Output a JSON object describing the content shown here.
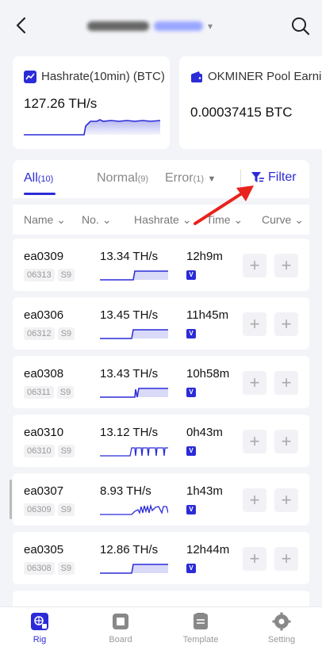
{
  "header": {
    "title_suffix": "▾"
  },
  "summary": {
    "hashrate": {
      "label": "Hashrate(10min) (BTC)",
      "value": "127.26 TH/s"
    },
    "earnings": {
      "label": "OKMINER Pool Earning",
      "value": "0.00037415 BTC"
    }
  },
  "tabs": {
    "all": {
      "label": "All",
      "count": "(10)"
    },
    "normal": {
      "label": "Normal",
      "count": "(9)"
    },
    "error": {
      "label": "Error",
      "count": "(1)"
    },
    "filter_label": "Filter"
  },
  "columns": [
    "Name",
    "No.",
    "Hashrate",
    "Time",
    "Curve"
  ],
  "rigs": [
    {
      "name": "ea0309",
      "no": "06313",
      "model": "S9",
      "hashrate": "13.34 TH/s",
      "time": "12h9m",
      "badge": "V"
    },
    {
      "name": "ea0306",
      "no": "06312",
      "model": "S9",
      "hashrate": "13.45 TH/s",
      "time": "11h45m",
      "badge": "V"
    },
    {
      "name": "ea0308",
      "no": "06311",
      "model": "S9",
      "hashrate": "13.43 TH/s",
      "time": "10h58m",
      "badge": "V"
    },
    {
      "name": "ea0310",
      "no": "06310",
      "model": "S9",
      "hashrate": "13.12 TH/s",
      "time": "0h43m",
      "badge": "V"
    },
    {
      "name": "ea0307",
      "no": "06309",
      "model": "S9",
      "hashrate": "8.93 TH/s",
      "time": "1h43m",
      "badge": "V"
    },
    {
      "name": "ea0305",
      "no": "06308",
      "model": "S9",
      "hashrate": "12.86 TH/s",
      "time": "12h44m",
      "badge": "V"
    }
  ],
  "tabbar": [
    {
      "label": "Rig",
      "icon": "rig-icon",
      "active": true
    },
    {
      "label": "Board",
      "icon": "board-icon",
      "active": false
    },
    {
      "label": "Template",
      "icon": "template-icon",
      "active": false
    },
    {
      "label": "Setting",
      "icon": "gear-icon",
      "active": false
    }
  ],
  "colors": {
    "accent": "#2b2bd8",
    "annotation_arrow": "#e8231c"
  }
}
